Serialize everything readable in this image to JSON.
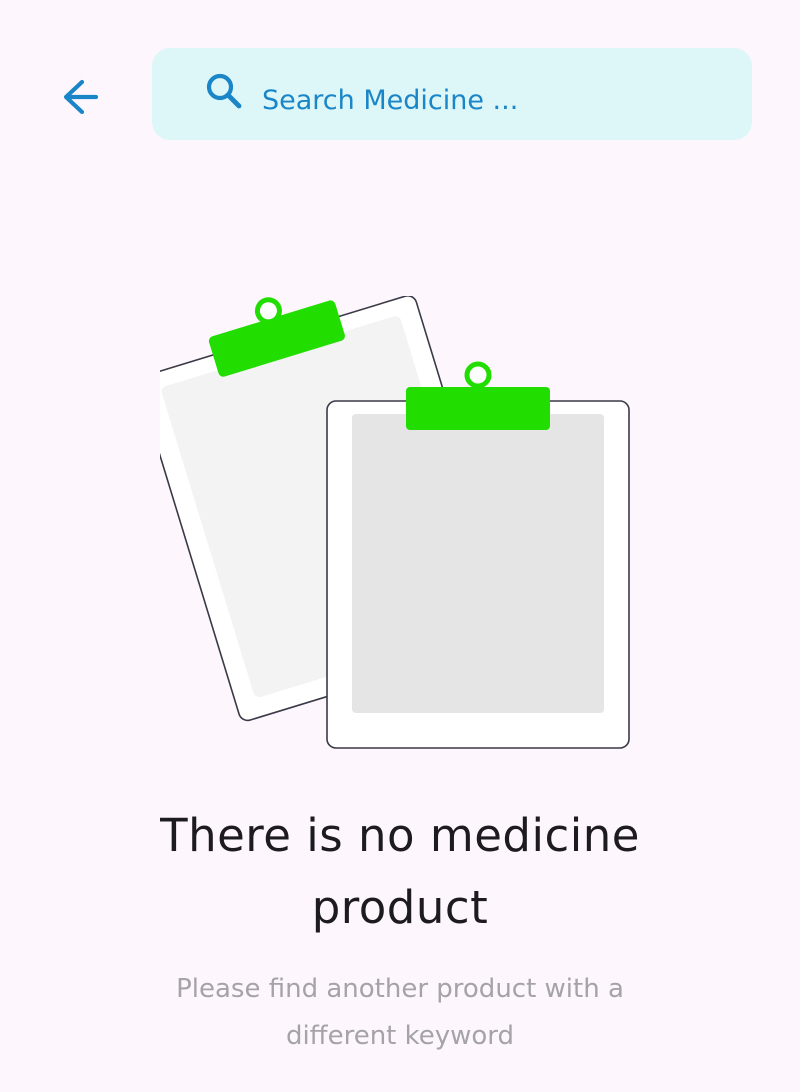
{
  "header": {
    "back_icon": "arrow-left-icon",
    "search": {
      "placeholder": "Search Medicine ...",
      "value": "",
      "icon": "search-icon"
    }
  },
  "empty_state": {
    "illustration": "clipboards-illustration",
    "title": "There is no medicine product",
    "subtitle": "Please find another product with a different keyword"
  },
  "colors": {
    "background": "#FDF7FD",
    "search_background": "#DDF6F8",
    "accent_blue": "#1A86C8",
    "clip_green": "#22DD00",
    "title": "#1D1B20",
    "subtitle": "#A5A3A8"
  }
}
